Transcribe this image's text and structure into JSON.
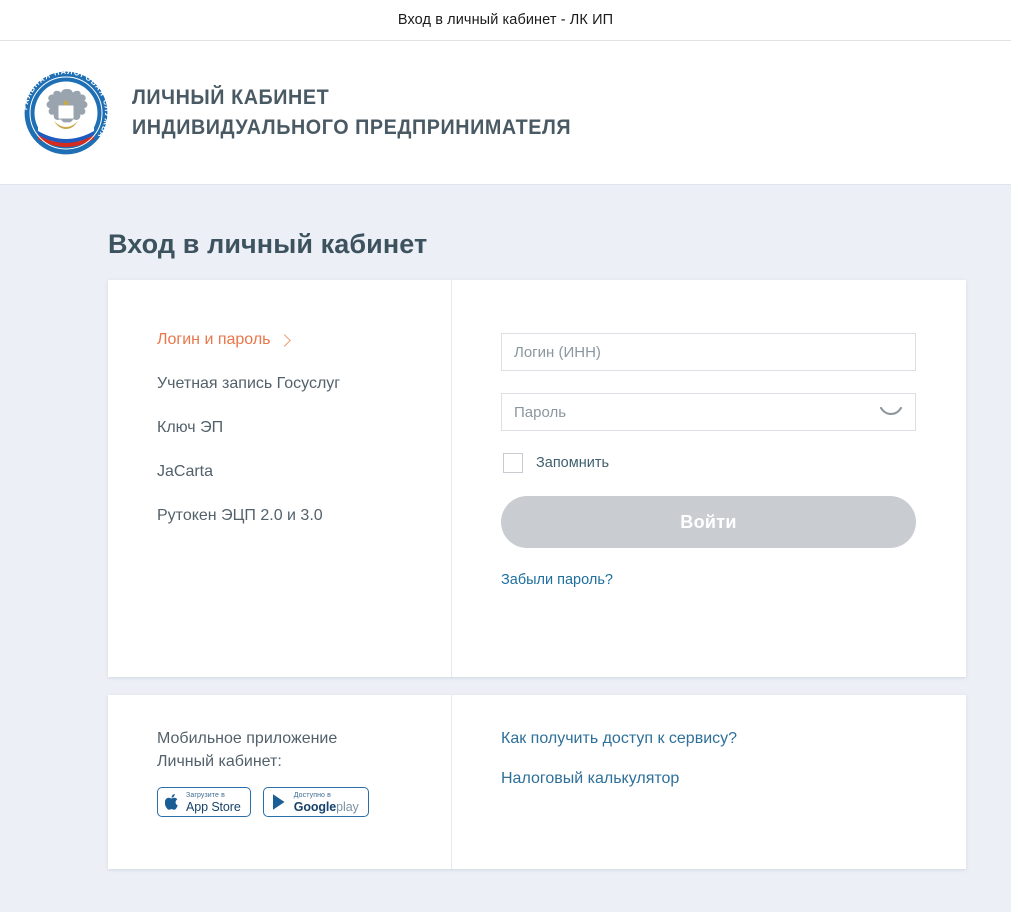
{
  "window": {
    "title": "Вход в личный кабинет - ЛК ИП"
  },
  "header": {
    "logo_icon": "fns-emblem-icon",
    "logo_ring_text": "ФЕДЕРАЛЬНАЯ НАЛОГОВАЯ СЛУЖБА",
    "brand_line1": "ЛИЧНЫЙ КАБИНЕТ",
    "brand_line2": "ИНДИВИДУАЛЬНОГО ПРЕДПРИНИМАТЕЛЯ"
  },
  "page": {
    "title": "Вход в личный кабинет"
  },
  "auth_methods": [
    {
      "label": "Логин и пароль",
      "active": true,
      "chevron_icon": "chevron-right-icon"
    },
    {
      "label": "Учетная запись Госуслуг",
      "active": false
    },
    {
      "label": "Ключ ЭП",
      "active": false
    },
    {
      "label": "JaCarta",
      "active": false
    },
    {
      "label": "Рутокен ЭЦП 2.0 и 3.0",
      "active": false
    }
  ],
  "form": {
    "login_placeholder": "Логин (ИНН)",
    "login_value": "",
    "password_placeholder": "Пароль",
    "password_value": "",
    "password_toggle_icon": "eye-closed-icon",
    "remember_label": "Запомнить",
    "remember_checked": false,
    "submit_label": "Войти",
    "submit_disabled": true,
    "forgot_label": "Забыли пароль?"
  },
  "mobile": {
    "title_line1": "Мобильное приложение",
    "title_line2": "Личный кабинет:",
    "badges": [
      {
        "small": "Загрузите в",
        "big": "App Store",
        "icon": "apple-logo-icon"
      },
      {
        "small": "Доступно в",
        "big": "Google",
        "big_suffix": "play",
        "icon": "google-play-icon"
      }
    ]
  },
  "info_links": [
    {
      "label": "Как получить доступ к сервису?"
    },
    {
      "label": "Налоговый калькулятор"
    }
  ],
  "colors": {
    "page_background": "#eceff5",
    "accent_orange": "#e8774a",
    "link_blue": "#2e7099",
    "brand_text": "#4a5a64",
    "button_disabled": "#c9cdd2",
    "badge_border": "#2c6ea8"
  }
}
